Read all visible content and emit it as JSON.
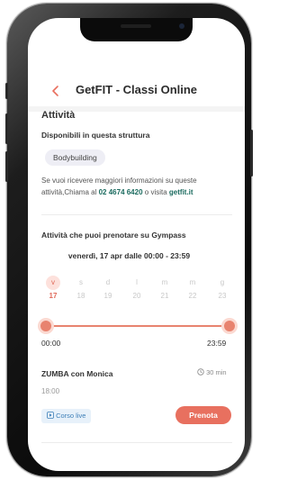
{
  "header": {
    "title": "GetFIT - Classi Online",
    "back_icon": "chevron-left-icon"
  },
  "activities": {
    "title": "Attività",
    "subtitle": "Disponibili in questa struttura",
    "chips": [
      "Bodybuilding"
    ],
    "info_prefix": "Se vuoi ricevere maggiori informazioni su queste attività,Chiama al",
    "phone": "02 4674 6420",
    "info_middle": "o visita",
    "link": "getfit.it"
  },
  "gympass": {
    "title": "Attività che puoi prenotare su Gympass",
    "date_range": "venerdì, 17 apr dalle 00:00 - 23:59",
    "days": [
      {
        "letter": "v",
        "num": "17",
        "selected": true
      },
      {
        "letter": "s",
        "num": "18",
        "selected": false
      },
      {
        "letter": "d",
        "num": "19",
        "selected": false
      },
      {
        "letter": "l",
        "num": "20",
        "selected": false
      },
      {
        "letter": "m",
        "num": "21",
        "selected": false
      },
      {
        "letter": "m",
        "num": "22",
        "selected": false
      },
      {
        "letter": "g",
        "num": "23",
        "selected": false
      }
    ],
    "time_start": "00:00",
    "time_end": "23:59"
  },
  "class_item": {
    "name": "ZUMBA con Monica",
    "duration": "30 min",
    "time": "18:00",
    "badge": "Corso live",
    "book_label": "Prenota"
  },
  "colors": {
    "accent": "#e8705f",
    "link": "#1b6b5f",
    "badge_bg": "#e7f1fa"
  }
}
